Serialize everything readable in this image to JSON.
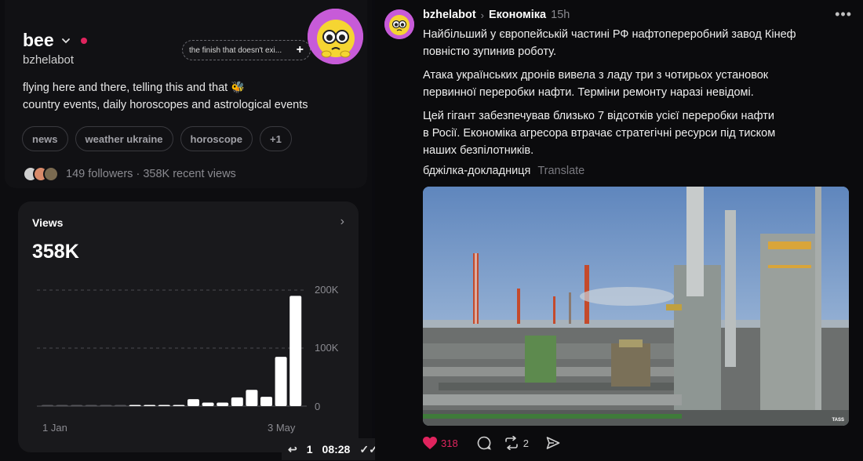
{
  "profile": {
    "name": "bee",
    "handle": "bzhelabot",
    "note": "the finish that doesn't exi...",
    "bio_line1": "flying here and there, telling this and that 🐝",
    "bio_line2": "country events, daily horoscopes and astrological events",
    "tags": [
      "news",
      "weather ukraine",
      "horoscope",
      "+1"
    ],
    "followers_text": "149 followers · 358K recent views"
  },
  "views": {
    "title": "Views",
    "total": "358K",
    "player_reply_count": "1",
    "player_time": "08:28"
  },
  "chart_data": {
    "type": "bar",
    "title": "Views",
    "xlabel": "",
    "ylabel": "",
    "ylim": [
      0,
      200000
    ],
    "y_ticks": [
      "0",
      "100K",
      "200K"
    ],
    "x_tick_labels": [
      "1 Jan",
      "3 May"
    ],
    "grid": true,
    "values": [
      0,
      0,
      0,
      0,
      0,
      0,
      2000,
      2000,
      1000,
      1000,
      12000,
      6000,
      6000,
      15000,
      28000,
      16000,
      85000,
      190000
    ]
  },
  "post": {
    "user": "bzhelabot",
    "topic": "Економіка",
    "time": "15h",
    "para1_line1": "Найбільший у європейській частині РФ нафтопереробний завод Кінеф",
    "para1_line2": "повністю зупинив роботу.",
    "para2_line1": "Атака українських дронів вивела з ладу три з чотирьох установок",
    "para2_line2": "первинної переробки нафти. Терміни ремонту наразі невідомі.",
    "para3_line1": "Цей гігант забезпечував близько 7 відсотків усієї переробки нафти",
    "para3_line2": "в Росії. Економіка агресора втрачає стратегічні ресурси під тиском",
    "para3_line3": "наших безпілотників.",
    "signature": "бджілка-докладниця",
    "translate_label": "Translate",
    "photo_credit": "TASS",
    "likes": "318",
    "reposts": "2"
  },
  "colors": {
    "accent_red": "#e0245e",
    "avatar_purple": "#c75bd8",
    "avatar_yellow": "#f5d532"
  }
}
